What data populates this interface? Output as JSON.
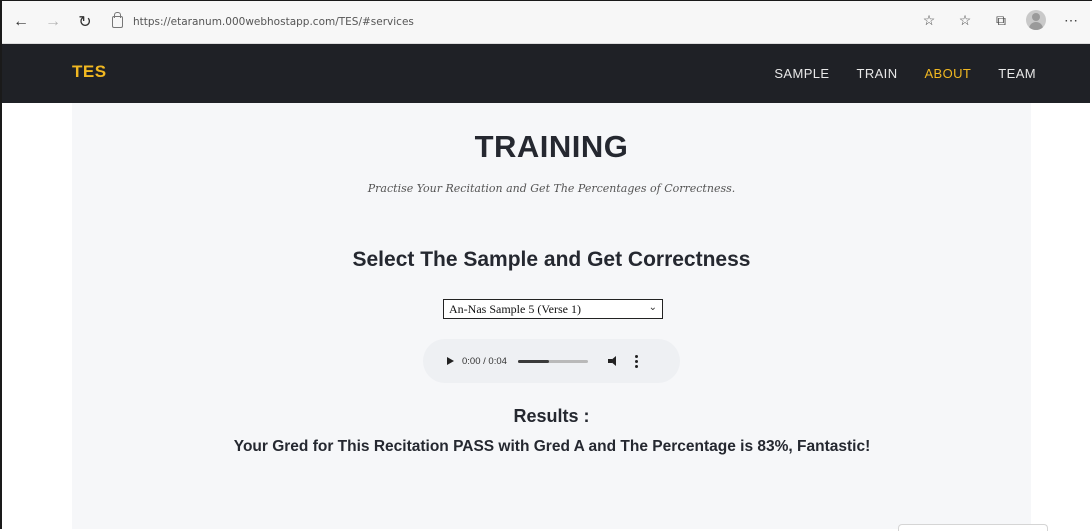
{
  "browser": {
    "url": "https://etaranum.000webhostapp.com/TES/#services"
  },
  "navbar": {
    "brand": "TES",
    "items": [
      {
        "label": "SAMPLE",
        "active": false
      },
      {
        "label": "TRAIN",
        "active": false
      },
      {
        "label": "ABOUT",
        "active": true
      },
      {
        "label": "TEAM",
        "active": false
      }
    ]
  },
  "main": {
    "title": "TRAINING",
    "subtitle": "Practise Your Recitation and Get The Percentages of Correctness.",
    "section_heading": "Select The Sample and Get Correctness",
    "sample_select": {
      "selected": "An-Nas Sample 5 (Verse 1)"
    },
    "audio": {
      "time": "0:00 / 0:04",
      "progress": 0.45
    },
    "results_heading": "Results :",
    "results_text": "Your Gred for This Recitation PASS with Gred A and The Percentage is 83%, Fantastic!"
  },
  "colors": {
    "navbar_bg": "#1f2126",
    "accent": "#f1b821",
    "content_bg": "#f6f7f9"
  }
}
